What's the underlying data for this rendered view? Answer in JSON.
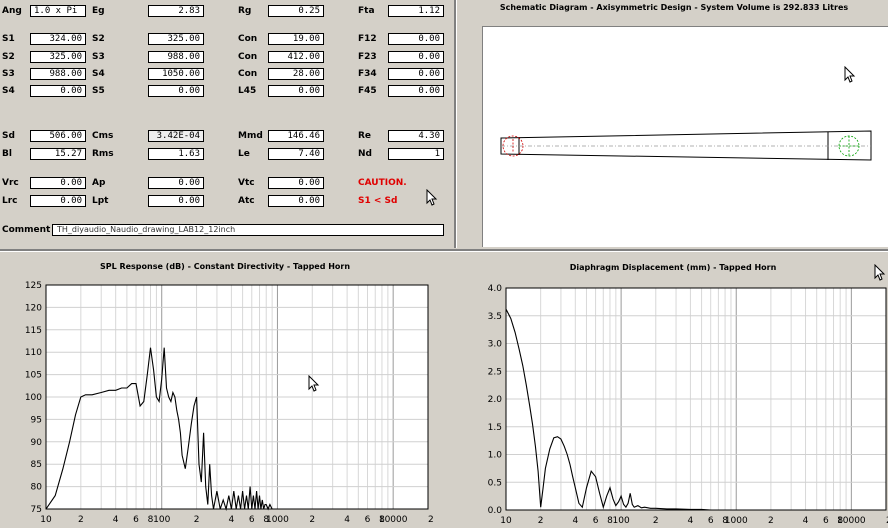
{
  "params": {
    "rows": [
      [
        {
          "label": "Ang",
          "value": "1.0 x Pi",
          "align": "left"
        },
        {
          "label": "Eg",
          "value": "2.83"
        },
        {
          "label": "Rg",
          "value": "0.25"
        },
        {
          "label": "Fta",
          "value": "1.12"
        }
      ],
      [
        {
          "label": "S1",
          "value": "324.00"
        },
        {
          "label": "S2",
          "value": "325.00"
        },
        {
          "label": "Con",
          "value": "19.00"
        },
        {
          "label": "F12",
          "value": "0.00"
        }
      ],
      [
        {
          "label": "S2",
          "value": "325.00"
        },
        {
          "label": "S3",
          "value": "988.00"
        },
        {
          "label": "Con",
          "value": "412.00"
        },
        {
          "label": "F23",
          "value": "0.00"
        }
      ],
      [
        {
          "label": "S3",
          "value": "988.00"
        },
        {
          "label": "S4",
          "value": "1050.00"
        },
        {
          "label": "Con",
          "value": "28.00"
        },
        {
          "label": "F34",
          "value": "0.00"
        }
      ],
      [
        {
          "label": "S4",
          "value": "0.00"
        },
        {
          "label": "S5",
          "value": "0.00"
        },
        {
          "label": "L45",
          "value": "0.00"
        },
        {
          "label": "F45",
          "value": "0.00"
        }
      ],
      [
        {
          "label": "Sd",
          "value": "506.00"
        },
        {
          "label": "Cms",
          "value": "3.42E-04"
        },
        {
          "label": "Mmd",
          "value": "146.46"
        },
        {
          "label": "Re",
          "value": "4.30"
        }
      ],
      [
        {
          "label": "Bl",
          "value": "15.27"
        },
        {
          "label": "Rms",
          "value": "1.63"
        },
        {
          "label": "Le",
          "value": "7.40"
        },
        {
          "label": "Nd",
          "value": "1"
        }
      ],
      [
        {
          "label": "Vrc",
          "value": "0.00"
        },
        {
          "label": "Ap",
          "value": "0.00"
        },
        {
          "label": "Vtc",
          "value": "0.00"
        },
        {
          "label": "CAUTION.",
          "value": null,
          "caution": true
        }
      ],
      [
        {
          "label": "Lrc",
          "value": "0.00"
        },
        {
          "label": "Lpt",
          "value": "0.00"
        },
        {
          "label": "Atc",
          "value": "0.00"
        },
        {
          "label": "S1 < Sd",
          "value": null,
          "caution": true
        }
      ]
    ],
    "comment_label": "Comment",
    "comment_value": "TH_diyaudio_Naudio_drawing_LAB12_12inch"
  },
  "schematic": {
    "title": "Schematic Diagram - Axisymmetric Design - System Volume is 292.833 Litres"
  },
  "spl_chart": {
    "title": "SPL Response (dB) - Constant Directivity - Tapped Horn",
    "y_ticks": [
      "125",
      "120",
      "115",
      "110",
      "105",
      "100",
      "95",
      "90",
      "85",
      "80",
      "75"
    ],
    "x_ticks": [
      {
        "f": 10,
        "t": "10"
      },
      {
        "f": 20,
        "t": "2"
      },
      {
        "f": 40,
        "t": "4"
      },
      {
        "f": 60,
        "t": "6"
      },
      {
        "f": 80,
        "t": "8"
      },
      {
        "f": 100,
        "t": "100"
      },
      {
        "f": 200,
        "t": "2"
      },
      {
        "f": 400,
        "t": "4"
      },
      {
        "f": 600,
        "t": "6"
      },
      {
        "f": 800,
        "t": "8"
      },
      {
        "f": 1000,
        "t": "1000"
      },
      {
        "f": 2000,
        "t": "2"
      },
      {
        "f": 4000,
        "t": "4"
      },
      {
        "f": 6000,
        "t": "6"
      },
      {
        "f": 8000,
        "t": "8"
      },
      {
        "f": 10000,
        "t": "10000"
      },
      {
        "f": 20000,
        "t": "2"
      }
    ]
  },
  "disp_chart": {
    "title": "Diaphragm Displacement (mm) - Tapped Horn",
    "y_ticks": [
      "4.0",
      "3.5",
      "3.0",
      "2.5",
      "2.0",
      "1.5",
      "1.0",
      "0.5",
      "0.0"
    ],
    "x_ticks": [
      {
        "f": 10,
        "t": "10"
      },
      {
        "f": 20,
        "t": "2"
      },
      {
        "f": 40,
        "t": "4"
      },
      {
        "f": 60,
        "t": "6"
      },
      {
        "f": 80,
        "t": "8"
      },
      {
        "f": 100,
        "t": "100"
      },
      {
        "f": 200,
        "t": "2"
      },
      {
        "f": 400,
        "t": "4"
      },
      {
        "f": 600,
        "t": "6"
      },
      {
        "f": 800,
        "t": "8"
      },
      {
        "f": 1000,
        "t": "1000"
      },
      {
        "f": 2000,
        "t": "2"
      },
      {
        "f": 4000,
        "t": "4"
      },
      {
        "f": 6000,
        "t": "6"
      },
      {
        "f": 8000,
        "t": "8"
      },
      {
        "f": 10000,
        "t": "10000"
      },
      {
        "f": 20000,
        "t": "2"
      }
    ]
  },
  "chart_data": [
    {
      "type": "line",
      "title": "SPL Response (dB) - Constant Directivity - Tapped Horn",
      "x_scale": "log",
      "xlim": [
        10,
        20000
      ],
      "ylim": [
        75,
        125
      ],
      "grid": true,
      "series": [
        {
          "x": [
            10,
            12,
            14,
            16,
            18,
            20,
            22,
            25,
            30,
            35,
            40,
            45,
            50,
            55,
            60,
            65,
            70,
            75,
            80,
            85,
            90,
            95,
            100,
            105,
            110,
            115,
            120,
            125,
            130,
            135,
            140,
            145,
            150,
            160,
            170,
            180,
            190,
            200,
            210,
            220,
            230,
            240,
            250,
            260,
            270,
            280,
            300,
            320,
            340,
            360,
            380,
            400,
            420,
            440,
            460,
            480,
            500,
            520,
            540,
            560,
            580,
            600,
            620,
            640,
            660,
            680,
            700,
            720,
            740,
            760,
            780,
            800,
            830,
            860,
            900,
            950,
            1000
          ],
          "y": [
            75,
            78,
            84,
            90,
            96,
            100,
            100.5,
            100.5,
            101,
            101.5,
            101.5,
            102,
            102,
            103,
            103,
            98,
            99,
            105,
            111,
            106,
            100,
            99,
            104,
            111,
            102,
            100,
            99,
            101,
            100,
            97,
            95,
            92,
            87,
            84,
            89,
            94,
            98,
            100,
            85,
            81,
            92,
            80,
            76,
            85,
            78,
            75,
            79,
            75,
            77,
            75,
            78,
            75,
            79,
            75,
            78,
            75,
            79,
            75,
            78,
            75,
            80,
            75,
            78,
            75,
            79,
            75,
            78,
            75,
            77,
            75,
            76,
            76,
            75,
            76,
            75,
            75,
            75
          ]
        }
      ]
    },
    {
      "type": "line",
      "title": "Diaphragm Displacement (mm) - Tapped Horn",
      "x_scale": "log",
      "xlim": [
        10,
        20000
      ],
      "ylim": [
        0,
        4.0
      ],
      "grid": true,
      "series": [
        {
          "x": [
            10,
            11,
            12,
            13,
            14,
            15,
            16,
            17,
            18,
            19,
            20,
            21,
            22,
            24,
            26,
            28,
            30,
            32,
            34,
            36,
            38,
            40,
            43,
            46,
            50,
            55,
            60,
            65,
            70,
            75,
            80,
            85,
            90,
            95,
            100,
            105,
            110,
            115,
            120,
            125,
            130,
            140,
            150,
            160,
            180,
            200,
            250,
            300,
            400,
            500,
            600,
            700,
            800,
            1000,
            2000,
            20000
          ],
          "y": [
            3.62,
            3.45,
            3.2,
            2.9,
            2.6,
            2.25,
            1.9,
            1.55,
            1.15,
            0.7,
            0.05,
            0.4,
            0.75,
            1.1,
            1.3,
            1.32,
            1.28,
            1.15,
            1.0,
            0.82,
            0.6,
            0.4,
            0.12,
            0.05,
            0.4,
            0.7,
            0.6,
            0.3,
            0.05,
            0.25,
            0.4,
            0.2,
            0.08,
            0.15,
            0.25,
            0.1,
            0.05,
            0.12,
            0.3,
            0.1,
            0.05,
            0.08,
            0.04,
            0.05,
            0.03,
            0.03,
            0.02,
            0.02,
            0.01,
            0.01,
            0.0,
            0.0,
            0.0,
            0.0,
            0.0,
            0.0
          ]
        }
      ]
    }
  ]
}
